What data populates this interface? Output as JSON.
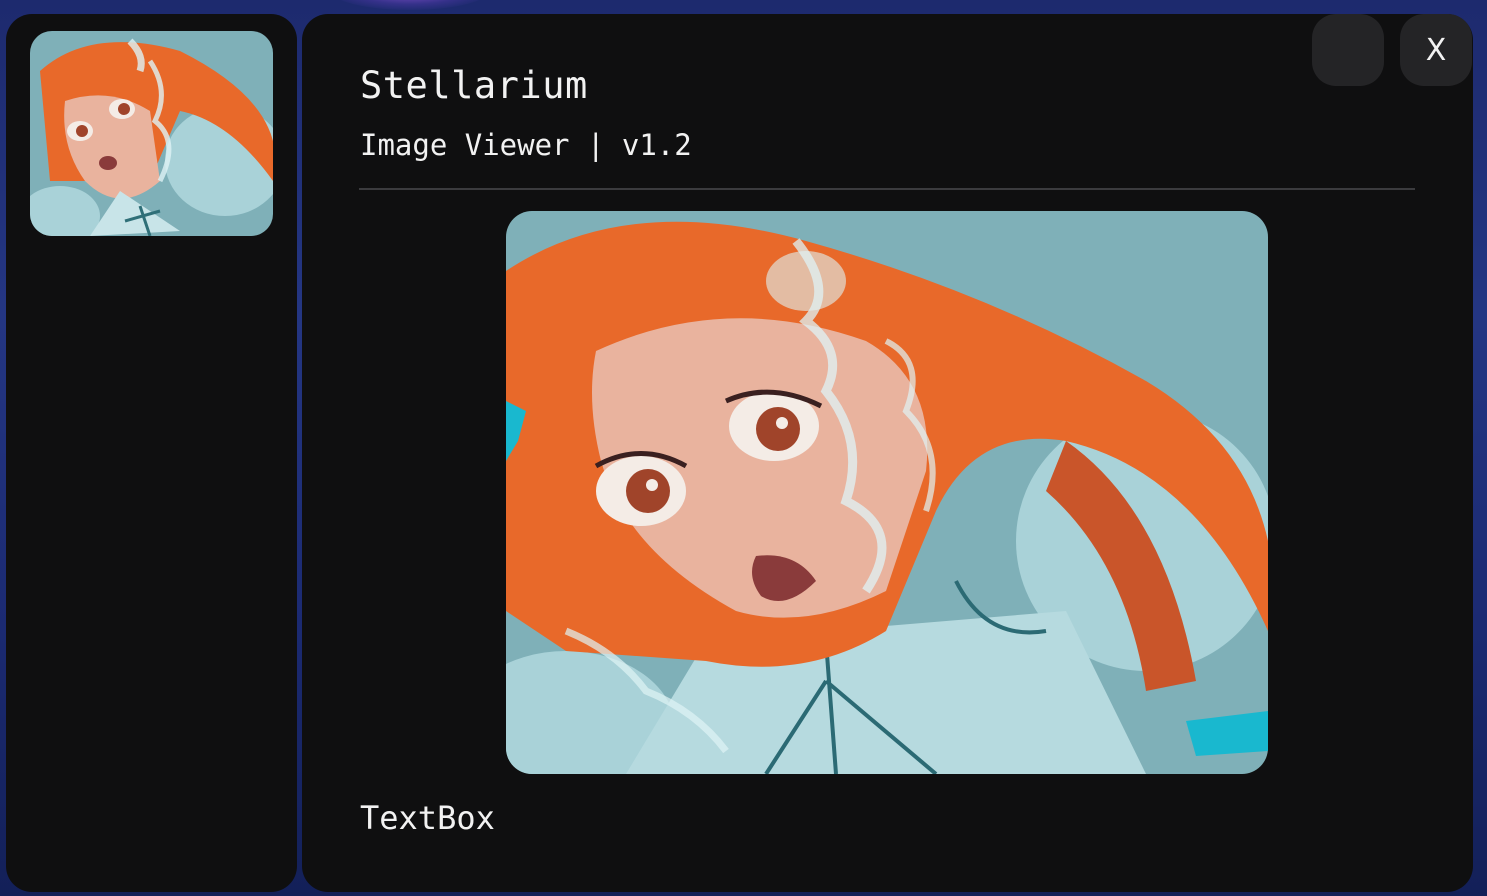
{
  "app": {
    "title": "Stellarium",
    "subtitle": "Image Viewer | v1.2"
  },
  "window_controls": {
    "blank_label": "",
    "close_label": "X"
  },
  "content": {
    "caption": "TextBox"
  },
  "colors": {
    "panel_bg": "#0f0f10",
    "button_bg": "#242426",
    "text": "#f2f2f2",
    "divider": "#3b3b3e",
    "image_bg": "#7fb0b8",
    "hair": "#e8692a"
  }
}
